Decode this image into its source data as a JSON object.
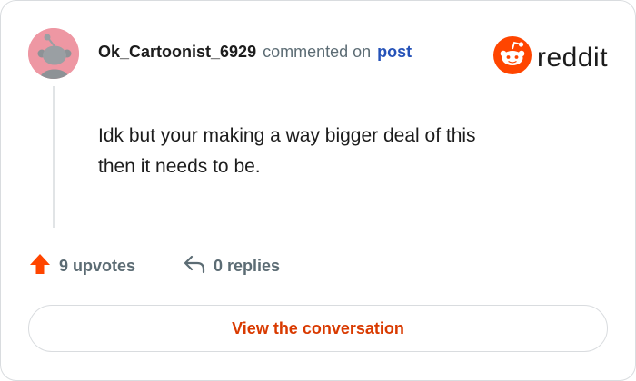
{
  "comment": {
    "author": "Ok_Cartoonist_6929",
    "action_text": "commented on",
    "post_link": "post",
    "body_lines": [
      "Idk but your making a way bigger deal of this",
      "then it needs to be."
    ]
  },
  "brand": {
    "wordmark": "reddit",
    "logo_icon": "reddit-snoo-icon",
    "color": "#ff4500"
  },
  "stats": {
    "upvotes_label": "9 upvotes",
    "replies_label": "0 replies",
    "upvote_icon": "upvote-arrow-icon",
    "reply_icon": "reply-arrow-icon",
    "upvote_color": "#ff4500"
  },
  "cta": {
    "label": "View the conversation",
    "color": "#d93a00"
  },
  "avatar": {
    "icon": "snoo-avatar-icon",
    "background": "#ee97a3"
  }
}
